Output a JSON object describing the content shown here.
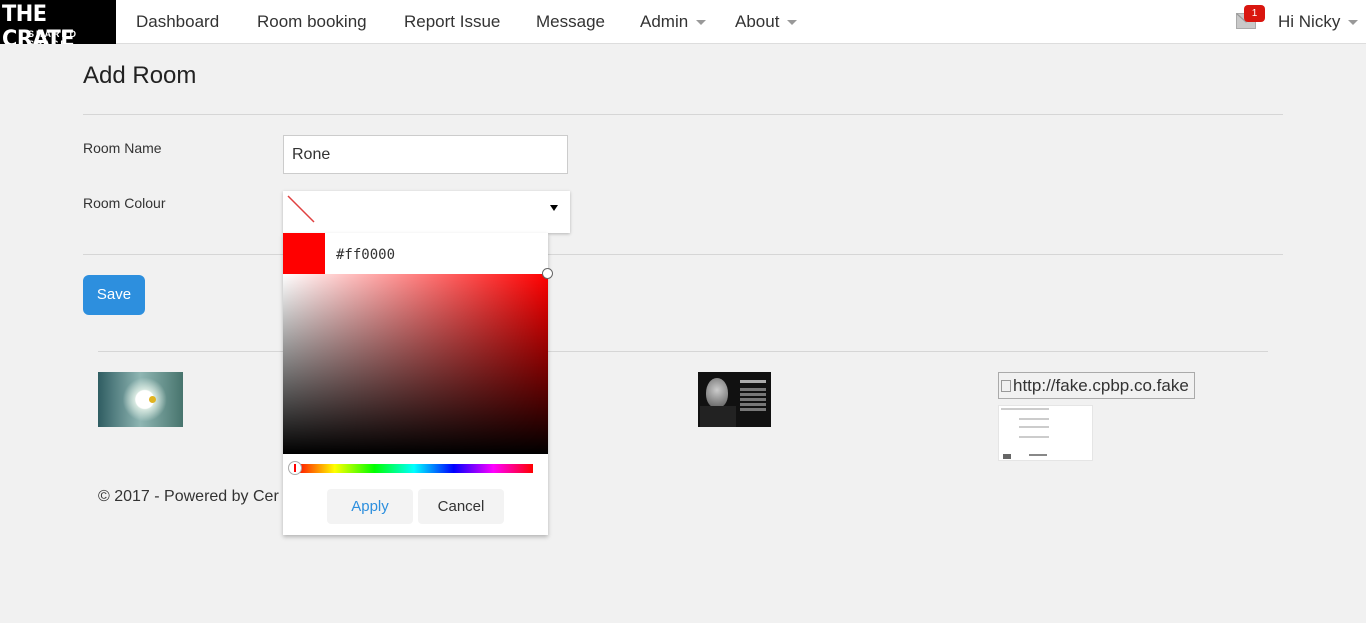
{
  "nav": {
    "logo_line1": "THE CRATE",
    "logo_line2": "SHARED SPACE",
    "items": [
      {
        "label": "Dashboard"
      },
      {
        "label": "Room booking"
      },
      {
        "label": "Report Issue"
      },
      {
        "label": "Message"
      },
      {
        "label": "Admin"
      },
      {
        "label": "About"
      }
    ],
    "notification_count": "1",
    "greeting": "Hi Nicky"
  },
  "page": {
    "title": "Add Room"
  },
  "form": {
    "room_name_label": "Room Name",
    "room_name_value": "Rone",
    "room_colour_label": "Room Colour",
    "save_label": "Save"
  },
  "color_picker": {
    "hex_value": "#ff0000",
    "apply_label": "Apply",
    "cancel_label": "Cancel",
    "selected_color": "#ff0000",
    "hue_position_percent": 0
  },
  "footer": {
    "copyright_visible": "© 2017 - Powered by Cer",
    "broken_image_alt": "http://fake.cpbp.co.fake"
  },
  "colors": {
    "accent": "#2d8fde",
    "badge": "#d9160f",
    "background": "#f1f1f1"
  }
}
